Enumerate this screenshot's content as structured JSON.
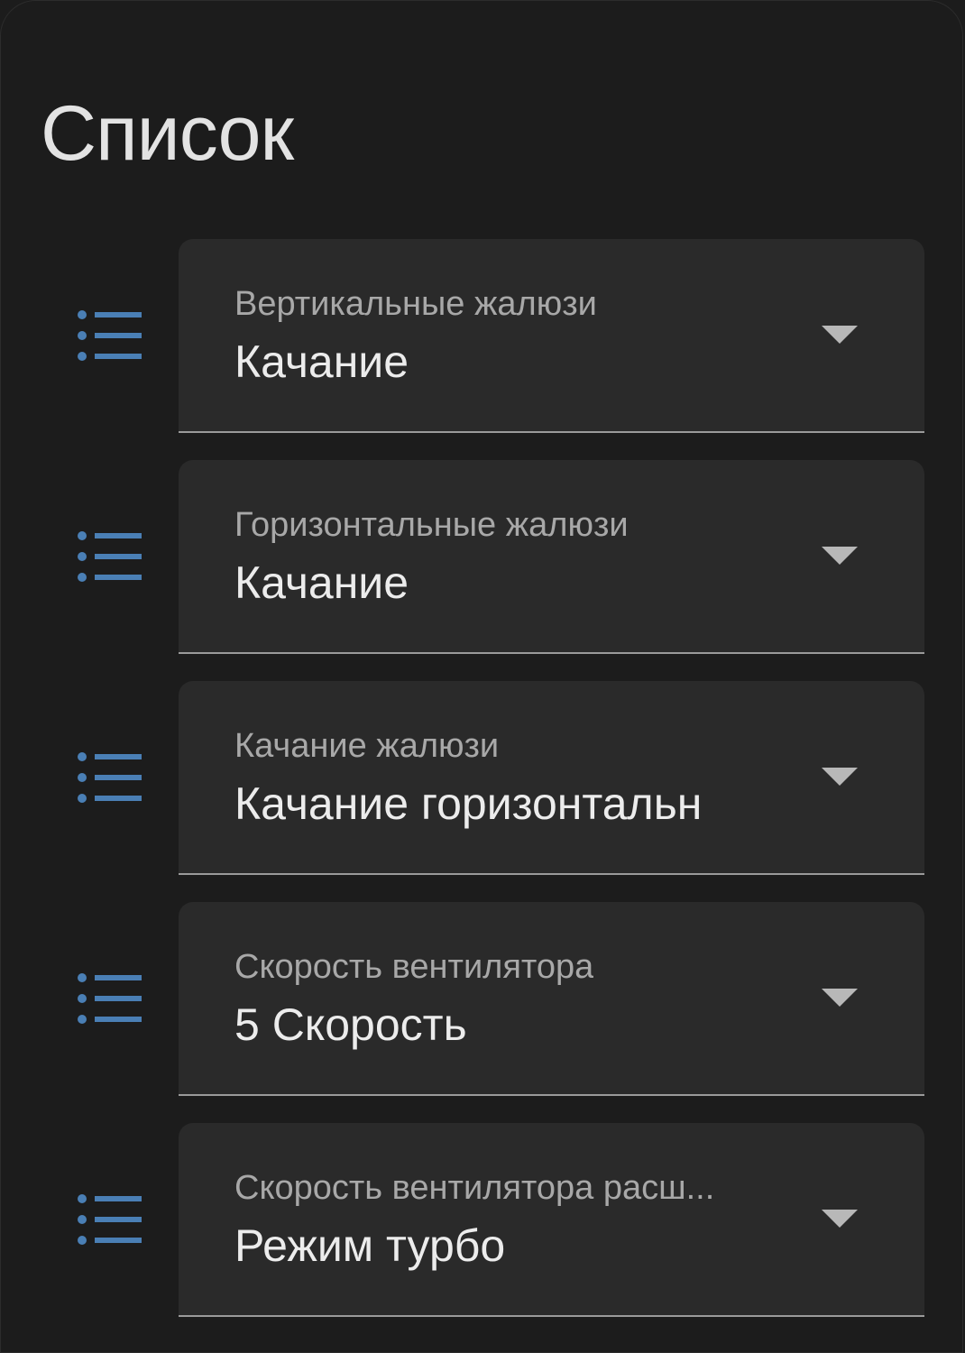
{
  "card": {
    "title": "Список"
  },
  "rows": [
    {
      "label": "Вертикальные жалюзи",
      "value": "Качание",
      "icon": "format-list-bulleted-icon"
    },
    {
      "label": "Горизонтальные жалюзи",
      "value": "Качание",
      "icon": "format-list-bulleted-icon"
    },
    {
      "label": "Качание жалюзи",
      "value": "Качание горизонтальн",
      "icon": "format-list-bulleted-icon"
    },
    {
      "label": "Скорость вентилятора",
      "value": "5 Скорость",
      "icon": "format-list-bulleted-icon"
    },
    {
      "label": "Скорость вентилятора расш...",
      "value": "Режим турбо",
      "icon": "format-list-bulleted-icon"
    }
  ],
  "colors": {
    "background": "#1c1c1c",
    "select_fill": "#2a2a2a",
    "icon": "#4a7fb5",
    "label": "#a8a8a8",
    "value": "#ececec",
    "caret": "#b8b8b8"
  }
}
